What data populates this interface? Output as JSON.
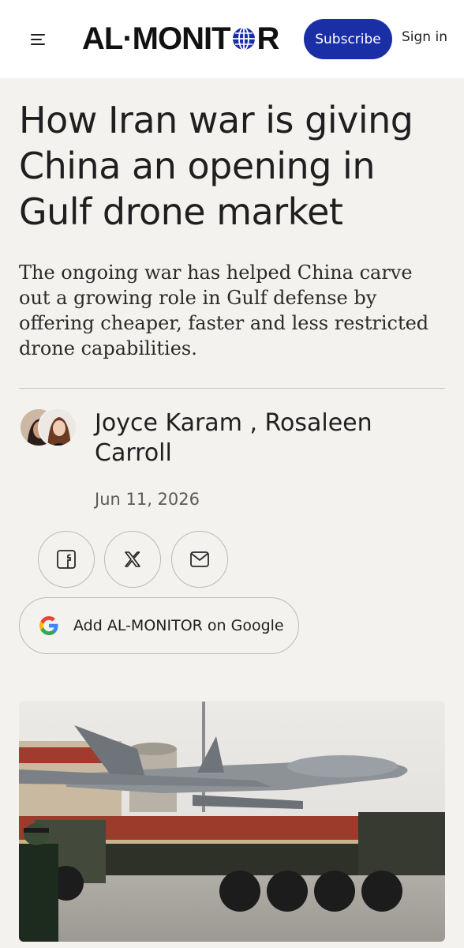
{
  "header": {
    "logo_left": "AL·MONIT",
    "logo_right": "R",
    "subscribe_label": "Subscribe",
    "signin_label": "Sign in",
    "menu_icon": "hamburger-menu-icon"
  },
  "article": {
    "headline": "How Iran war is giving China an opening in Gulf drone market",
    "dek": "The ongoing war has helped China carve out a growing role in Gulf defense by offering cheaper, faster and less restricted drone capabilities.",
    "authors": "Joyce Karam , Rosaleen Carroll",
    "date": "Jun 11, 2026"
  },
  "share": {
    "icons": [
      "facebook-icon",
      "x-icon",
      "mail-icon"
    ]
  },
  "google_button": {
    "label": "Add AL-MONITOR on Google",
    "icon": "google-icon"
  },
  "colors": {
    "brand_blue": "#1a2fa6",
    "background": "#f4f2ef"
  }
}
